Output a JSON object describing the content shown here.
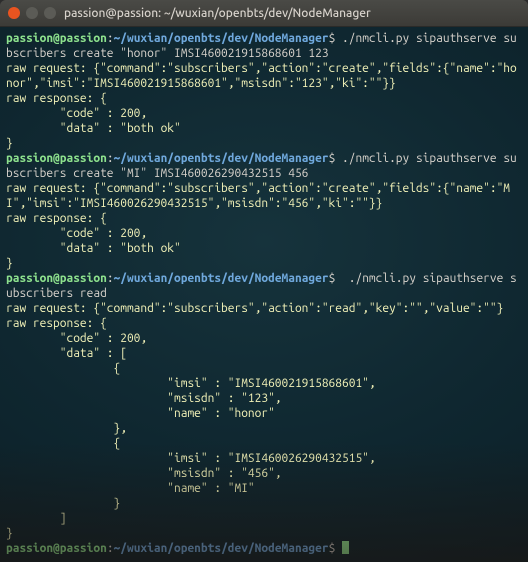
{
  "window": {
    "title": "passion@passion: ~/wuxian/openbts/dev/NodeManager"
  },
  "prompt": {
    "user_host": "passion@passion",
    "sep1": ":",
    "path": "~/wuxian/openbts/dev/NodeManager",
    "sep2": "$"
  },
  "cmds": {
    "c1": " ./nmcli.py sipauthserve subscribers create \"honor\" IMSI460021915868601 123",
    "c2": " ./nmcli.py sipauthserve subscribers create \"MI\" IMSI460026290432515 456",
    "c3": "  ./nmcli.py sipauthserve subscribers read"
  },
  "out": {
    "req1": "raw request: {\"command\":\"subscribers\",\"action\":\"create\",\"fields\":{\"name\":\"honor\",\"imsi\":\"IMSI460021915868601\",\"msisdn\":\"123\",\"ki\":\"\"}}",
    "resp_open": "raw response: {",
    "code_line": "        \"code\" : 200,",
    "data_both": "        \"data\" : \"both ok\"",
    "brace_close": "}",
    "req2": "raw request: {\"command\":\"subscribers\",\"action\":\"create\",\"fields\":{\"name\":\"MI\",\"imsi\":\"IMSI460026290432515\",\"msisdn\":\"456\",\"ki\":\"\"}}",
    "req3": "raw request: {\"command\":\"subscribers\",\"action\":\"read\",\"key\":\"\",\"value\":\"\"}",
    "data_arr_open": "        \"data\" : [",
    "obj_open": "                {",
    "r1_imsi": "                        \"imsi\" : \"IMSI460021915868601\",",
    "r1_msisdn": "                        \"msisdn\" : \"123\",",
    "r1_name": "                        \"name\" : \"honor\"",
    "obj_close_c": "                },",
    "r2_imsi": "                        \"imsi\" : \"IMSI460026290432515\",",
    "r2_msisdn": "                        \"msisdn\" : \"456\",",
    "r2_name": "                        \"name\" : \"MI\"",
    "obj_close": "                }",
    "arr_close": "        ]"
  }
}
